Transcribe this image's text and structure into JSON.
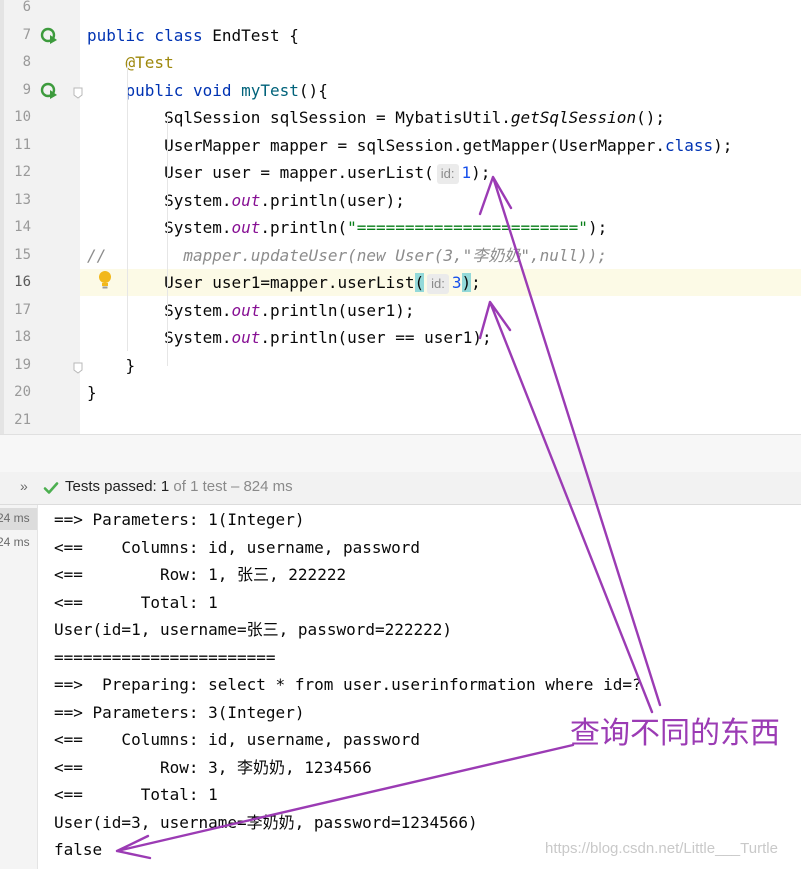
{
  "editor": {
    "line_numbers": [
      "6",
      "7",
      "8",
      "9",
      "10",
      "11",
      "12",
      "13",
      "14",
      "15",
      "16",
      "17",
      "18",
      "19",
      "20",
      "21"
    ],
    "current_line": "16",
    "lines": [
      {
        "n": "6",
        "segs": []
      },
      {
        "n": "7",
        "segs": [
          {
            "t": "public class ",
            "c": "kw"
          },
          {
            "t": "EndTest {",
            "c": ""
          }
        ]
      },
      {
        "n": "8",
        "segs": [
          {
            "t": "    ",
            "c": ""
          },
          {
            "t": "@Test",
            "c": "ann"
          }
        ]
      },
      {
        "n": "9",
        "segs": [
          {
            "t": "    ",
            "c": ""
          },
          {
            "t": "public void ",
            "c": "kw"
          },
          {
            "t": "myTest",
            "c": "fn"
          },
          {
            "t": "(){",
            "c": ""
          }
        ]
      },
      {
        "n": "10",
        "segs": [
          {
            "t": "        SqlSession sqlSession = MybatisUtil.",
            "c": ""
          },
          {
            "t": "getSqlSession",
            "c": "it"
          },
          {
            "t": "();",
            "c": ""
          }
        ]
      },
      {
        "n": "11",
        "segs": [
          {
            "t": "        UserMapper mapper = sqlSession.getMapper(UserMapper.",
            "c": ""
          },
          {
            "t": "class",
            "c": "kw"
          },
          {
            "t": ");",
            "c": ""
          }
        ]
      },
      {
        "n": "12",
        "segs": [
          {
            "t": "        User user = mapper.userList(",
            "c": ""
          },
          {
            "t": "id:",
            "c": "hint"
          },
          {
            "t": "1",
            "c": "num"
          },
          {
            "t": ");",
            "c": ""
          }
        ]
      },
      {
        "n": "13",
        "segs": [
          {
            "t": "        System.",
            "c": ""
          },
          {
            "t": "out",
            "c": "st"
          },
          {
            "t": ".println(user);",
            "c": ""
          }
        ]
      },
      {
        "n": "14",
        "segs": [
          {
            "t": "        System.",
            "c": ""
          },
          {
            "t": "out",
            "c": "st"
          },
          {
            "t": ".println(",
            "c": ""
          },
          {
            "t": "\"=======================\"",
            "c": "str"
          },
          {
            "t": ");",
            "c": ""
          }
        ]
      },
      {
        "n": "15",
        "segs": [
          {
            "t": "//        mapper.updateUser(new User(3,\"李奶奶\",null));",
            "c": "cmt"
          }
        ]
      },
      {
        "n": "16",
        "segs": [
          {
            "t": "        User user1=mapper.userList",
            "c": ""
          },
          {
            "t": "(",
            "c": "paren-hl"
          },
          {
            "t": "id:",
            "c": "hint"
          },
          {
            "t": "3",
            "c": "num"
          },
          {
            "t": ")",
            "c": "paren-hl"
          },
          {
            "t": ";",
            "c": ""
          }
        ]
      },
      {
        "n": "17",
        "segs": [
          {
            "t": "        System.",
            "c": ""
          },
          {
            "t": "out",
            "c": "st"
          },
          {
            "t": ".println(user1);",
            "c": ""
          }
        ]
      },
      {
        "n": "18",
        "segs": [
          {
            "t": "        System.",
            "c": ""
          },
          {
            "t": "out",
            "c": "st"
          },
          {
            "t": ".println(user == user1);",
            "c": ""
          }
        ]
      },
      {
        "n": "19",
        "segs": [
          {
            "t": "    }",
            "c": ""
          }
        ]
      },
      {
        "n": "20",
        "segs": [
          {
            "t": "}",
            "c": ""
          }
        ]
      },
      {
        "n": "21",
        "segs": []
      }
    ]
  },
  "test_status": {
    "expand_label": "»",
    "label": "Tests passed:",
    "passed": "1",
    "rest": "of 1 test – 824 ms"
  },
  "tree_times": [
    "24 ms",
    "24 ms"
  ],
  "console_lines": [
    "==> Parameters: 1(Integer)",
    "<==    Columns: id, username, password",
    "<==        Row: 1, 张三, 222222",
    "<==      Total: 1",
    "User(id=1, username=张三, password=222222)",
    "=======================",
    "==>  Preparing: select * from user.userinformation where id=?",
    "==> Parameters: 3(Integer)",
    "<==    Columns: id, username, password",
    "<==        Row: 3, 李奶奶, 1234566",
    "<==      Total: 1",
    "User(id=3, username=李奶奶, password=1234566)",
    "false"
  ],
  "annotation_text": "查询不同的东西",
  "watermark": "https://blog.csdn.net/Little___Turtle",
  "colors": {
    "annotation": "#9b3bb4",
    "keyword": "#0033b3",
    "number": "#1750eb",
    "string": "#067d17",
    "check": "#4caf50"
  }
}
